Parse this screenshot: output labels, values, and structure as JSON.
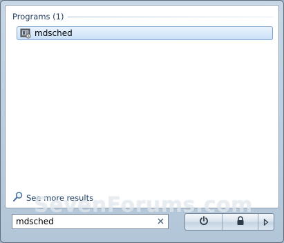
{
  "results": {
    "group_title": "Programs (1)",
    "items": [
      {
        "label": "mdsched",
        "icon": "memory-diagnostic-icon"
      }
    ]
  },
  "see_more": {
    "label": "See more results",
    "icon": "search-magnifier-icon"
  },
  "search": {
    "value": "mdsched",
    "clear_icon": "clear-x-icon"
  },
  "power_buttons": {
    "shutdown_icon": "power-icon",
    "lock_icon": "lock-icon",
    "options_icon": "arrow-right-icon"
  },
  "watermark": "SevenForums.com",
  "colors": {
    "accent": "#7da2ce",
    "header_text": "#1e395b",
    "frame": "#b2c6d8"
  }
}
